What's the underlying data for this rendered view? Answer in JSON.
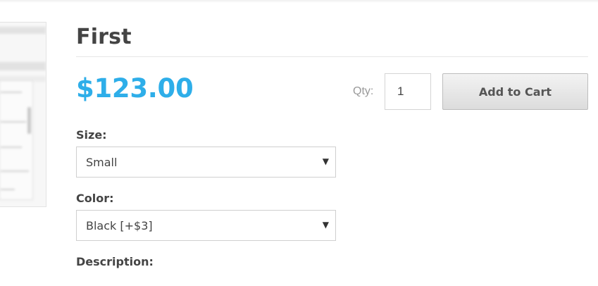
{
  "product": {
    "title": "First",
    "price": "$123.00"
  },
  "purchase": {
    "qty_label": "Qty:",
    "qty_value": "1",
    "add_to_cart_label": "Add to Cart"
  },
  "options": {
    "size": {
      "label": "Size:",
      "selected": "Small"
    },
    "color": {
      "label": "Color:",
      "selected": "Black [+$3]"
    }
  },
  "description": {
    "label": "Description:"
  },
  "colors": {
    "price": "#2eaee9",
    "text": "#444444",
    "muted": "#999999"
  },
  "icons": {
    "select_caret": "chevron-down-icon"
  }
}
